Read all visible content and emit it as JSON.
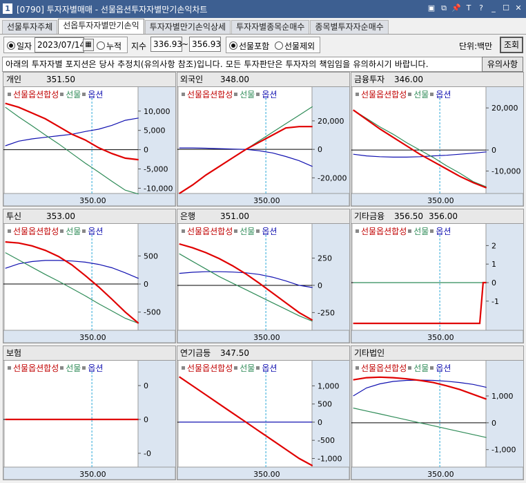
{
  "window": {
    "num": "1",
    "title": "[0790] 투자자별매매 - 선물옵션투자자별만기손익차트",
    "buttons": [
      "▣",
      "⧉",
      "📌",
      "T",
      "?",
      "_",
      "☐",
      "✕"
    ]
  },
  "tabs": [
    {
      "label": "선물투자주체",
      "active": false
    },
    {
      "label": "선옵투자자별만기손익",
      "active": true
    },
    {
      "label": "투자자별만기손익상세",
      "active": false
    },
    {
      "label": "투자자별종목순매수",
      "active": false
    },
    {
      "label": "종목별투자자순매수",
      "active": false
    }
  ],
  "filter": {
    "daily_label": "일자",
    "date": "2023/07/14",
    "cumulative_label": "누적",
    "index_label": "지수",
    "index_from": "336.93",
    "index_sep": "~",
    "index_to": "356.93",
    "include_futures_label": "선물포함",
    "exclude_futures_label": "선물제외",
    "unit_label": "단위:백만",
    "query_label": "조회"
  },
  "notice": {
    "text": "아래의 투자자별 포지션은 당사 추정치(유의사항 참조)입니다. 모든 투자판단은 투자자의 책임임을 유의하시기 바랍니다.",
    "button": "유의사항"
  },
  "legend": {
    "combined": "선물옵션합성",
    "futures": "선물",
    "options": "옵션"
  },
  "colors": {
    "combined": "#e00000",
    "futures": "#2e8b57",
    "options": "#1010b0",
    "zero": "#000000",
    "vline": "#2aa8d8",
    "axis_bg": "#dbe5f1"
  },
  "x_tick_label": "350.00",
  "panels": [
    {
      "name": "개인",
      "v1": "351.50",
      "v2": "",
      "yticks": [
        "10,000",
        "5,000",
        "0",
        "-5,000",
        "-10,000"
      ]
    },
    {
      "name": "외국인",
      "v1": "348.00",
      "v2": "",
      "yticks": [
        "20,000",
        "0",
        "-20,000"
      ]
    },
    {
      "name": "금융투자",
      "v1": "346.00",
      "v2": "",
      "yticks": [
        "20,000",
        "0",
        "-10,000"
      ]
    },
    {
      "name": "투신",
      "v1": "353.00",
      "v2": "",
      "yticks": [
        "500",
        "0",
        "-500"
      ]
    },
    {
      "name": "은행",
      "v1": "351.00",
      "v2": "",
      "yticks": [
        "250",
        "0",
        "-250"
      ]
    },
    {
      "name": "기타금융",
      "v1": "356.50",
      "v2": "356.00",
      "yticks": [
        "2",
        "1",
        "0",
        "-1"
      ]
    },
    {
      "name": "보험",
      "v1": "",
      "v2": "",
      "yticks": [
        "0",
        "0",
        "-0"
      ]
    },
    {
      "name": "연기금등",
      "v1": "347.50",
      "v2": "",
      "yticks": [
        "1,000",
        "500",
        "0",
        "-500",
        "-1,000"
      ]
    },
    {
      "name": "기타법인",
      "v1": "",
      "v2": "",
      "yticks": [
        "1,000",
        "0",
        "-1,000"
      ]
    }
  ],
  "chart_data": [
    {
      "type": "line",
      "title": "개인",
      "x": [
        337,
        339,
        341,
        343,
        345,
        347,
        349,
        351,
        353,
        355,
        357
      ],
      "xlim": [
        336.93,
        356.93
      ],
      "ylim": [
        -11000,
        13000
      ],
      "series": [
        {
          "name": "선물옵션합성",
          "values": [
            12000,
            11000,
            9500,
            8000,
            6000,
            4000,
            2500,
            500,
            -1000,
            -2200,
            -2600
          ]
        },
        {
          "name": "선물",
          "values": [
            11000,
            8500,
            6200,
            3800,
            1500,
            -1000,
            -3500,
            -5800,
            -8200,
            -10500,
            -11500
          ]
        },
        {
          "name": "옵션",
          "values": [
            1000,
            2200,
            2800,
            3200,
            3600,
            4000,
            4700,
            5300,
            6300,
            7600,
            8200
          ]
        }
      ]
    },
    {
      "type": "line",
      "title": "외국인",
      "x": [
        337,
        339,
        341,
        343,
        345,
        347,
        349,
        351,
        353,
        355,
        357
      ],
      "xlim": [
        336.93,
        356.93
      ],
      "ylim": [
        -30000,
        35000
      ],
      "series": [
        {
          "name": "선물옵션합성",
          "values": [
            -31000,
            -25000,
            -18000,
            -12000,
            -6000,
            0,
            5000,
            10000,
            15000,
            16000,
            16000
          ]
        },
        {
          "name": "선물",
          "values": [
            -31000,
            -25000,
            -18000,
            -12000,
            -6000,
            0,
            6000,
            12000,
            18000,
            24000,
            30000
          ]
        },
        {
          "name": "옵션",
          "values": [
            1000,
            1000,
            800,
            500,
            200,
            0,
            -1000,
            -2500,
            -5000,
            -8000,
            -12000
          ]
        }
      ]
    },
    {
      "type": "line",
      "title": "금융투자",
      "x": [
        337,
        339,
        341,
        343,
        345,
        347,
        349,
        351,
        353,
        355,
        357
      ],
      "xlim": [
        336.93,
        356.93
      ],
      "ylim": [
        -20000,
        24000
      ],
      "series": [
        {
          "name": "선물옵션합성",
          "values": [
            19000,
            14500,
            10000,
            6000,
            2000,
            -2000,
            -5500,
            -9000,
            -12500,
            -15500,
            -18000
          ]
        },
        {
          "name": "선물",
          "values": [
            19000,
            15000,
            11000,
            7500,
            3500,
            0,
            -3500,
            -7500,
            -11000,
            -15000,
            -17500
          ]
        },
        {
          "name": "옵션",
          "values": [
            -2000,
            -2800,
            -3200,
            -3400,
            -3400,
            -3200,
            -2800,
            -2500,
            -2000,
            -1500,
            -900
          ]
        }
      ]
    },
    {
      "type": "line",
      "title": "투신",
      "x": [
        337,
        339,
        341,
        343,
        345,
        347,
        349,
        351,
        353,
        355,
        357
      ],
      "xlim": [
        336.93,
        356.93
      ],
      "ylim": [
        -800,
        850
      ],
      "series": [
        {
          "name": "선물옵션합성",
          "values": [
            750,
            730,
            680,
            600,
            490,
            340,
            150,
            -50,
            -270,
            -500,
            -700
          ]
        },
        {
          "name": "선물",
          "values": [
            560,
            430,
            300,
            170,
            50,
            -80,
            -210,
            -350,
            -480,
            -610,
            -700
          ]
        },
        {
          "name": "옵션",
          "values": [
            280,
            360,
            400,
            420,
            420,
            410,
            390,
            350,
            290,
            200,
            100
          ]
        }
      ]
    },
    {
      "type": "line",
      "title": "은행",
      "x": [
        337,
        339,
        341,
        343,
        345,
        347,
        349,
        351,
        353,
        355,
        357
      ],
      "xlim": [
        336.93,
        356.93
      ],
      "ylim": [
        -400,
        450
      ],
      "series": [
        {
          "name": "선물옵션합성",
          "values": [
            380,
            345,
            300,
            245,
            180,
            105,
            20,
            -70,
            -160,
            -250,
            -320
          ]
        },
        {
          "name": "선물",
          "values": [
            290,
            220,
            150,
            80,
            20,
            -40,
            -100,
            -160,
            -220,
            -280,
            -330
          ]
        },
        {
          "name": "옵션",
          "values": [
            110,
            120,
            125,
            125,
            122,
            115,
            100,
            75,
            40,
            0,
            -20
          ]
        }
      ]
    },
    {
      "type": "line",
      "title": "기타금융",
      "x": [
        337,
        339,
        341,
        343,
        345,
        347,
        349,
        351,
        353,
        355,
        356,
        356.5,
        357
      ],
      "xlim": [
        336.93,
        356.93
      ],
      "ylim": [
        -2.5,
        2.5
      ],
      "series": [
        {
          "name": "선물옵션합성",
          "values": [
            -2.2,
            -2.2,
            -2.2,
            -2.2,
            -2.2,
            -2.2,
            -2.2,
            -2.2,
            -2.2,
            -2.2,
            -2.2,
            0,
            0
          ]
        },
        {
          "name": "선물",
          "values": [
            0,
            0,
            0,
            0,
            0,
            0,
            0,
            0,
            0,
            0,
            0,
            0,
            0
          ]
        },
        {
          "name": "옵션",
          "values": [
            -2.2,
            -2.2,
            -2.2,
            -2.2,
            -2.2,
            -2.2,
            -2.2,
            -2.2,
            -2.2,
            -2.2,
            -2.2,
            0,
            0
          ]
        }
      ]
    },
    {
      "type": "line",
      "title": "보험",
      "x": [
        337,
        357
      ],
      "xlim": [
        336.93,
        356.93
      ],
      "ylim": [
        -1,
        1
      ],
      "series": [
        {
          "name": "선물옵션합성",
          "values": [
            0,
            0
          ]
        },
        {
          "name": "선물",
          "values": [
            0,
            0
          ]
        },
        {
          "name": "옵션",
          "values": [
            0,
            0
          ]
        }
      ]
    },
    {
      "type": "line",
      "title": "연기금등",
      "x": [
        337,
        339,
        341,
        343,
        345,
        347,
        349,
        351,
        353,
        355,
        357
      ],
      "xlim": [
        336.93,
        356.93
      ],
      "ylim": [
        -1200,
        1350
      ],
      "series": [
        {
          "name": "선물옵션합성",
          "values": [
            1250,
            1000,
            750,
            500,
            250,
            0,
            -250,
            -500,
            -750,
            -1000,
            -1200
          ]
        },
        {
          "name": "선물",
          "values": [
            1250,
            1000,
            750,
            500,
            250,
            0,
            -250,
            -500,
            -750,
            -1000,
            -1200
          ]
        },
        {
          "name": "옵션",
          "values": [
            0,
            0,
            0,
            0,
            0,
            0,
            0,
            0,
            0,
            0,
            0
          ]
        }
      ]
    },
    {
      "type": "line",
      "title": "기타법인",
      "x": [
        337,
        339,
        341,
        343,
        345,
        347,
        349,
        351,
        353,
        355,
        357
      ],
      "xlim": [
        336.93,
        356.93
      ],
      "ylim": [
        -1600,
        1850
      ],
      "series": [
        {
          "name": "선물옵션합성",
          "values": [
            1600,
            1680,
            1700,
            1680,
            1640,
            1580,
            1500,
            1380,
            1240,
            1060,
            880
          ]
        },
        {
          "name": "선물",
          "values": [
            550,
            440,
            330,
            220,
            110,
            0,
            -110,
            -220,
            -330,
            -440,
            -550
          ]
        },
        {
          "name": "옵션",
          "values": [
            1000,
            1300,
            1450,
            1540,
            1580,
            1590,
            1580,
            1550,
            1500,
            1430,
            1320
          ]
        }
      ]
    }
  ]
}
